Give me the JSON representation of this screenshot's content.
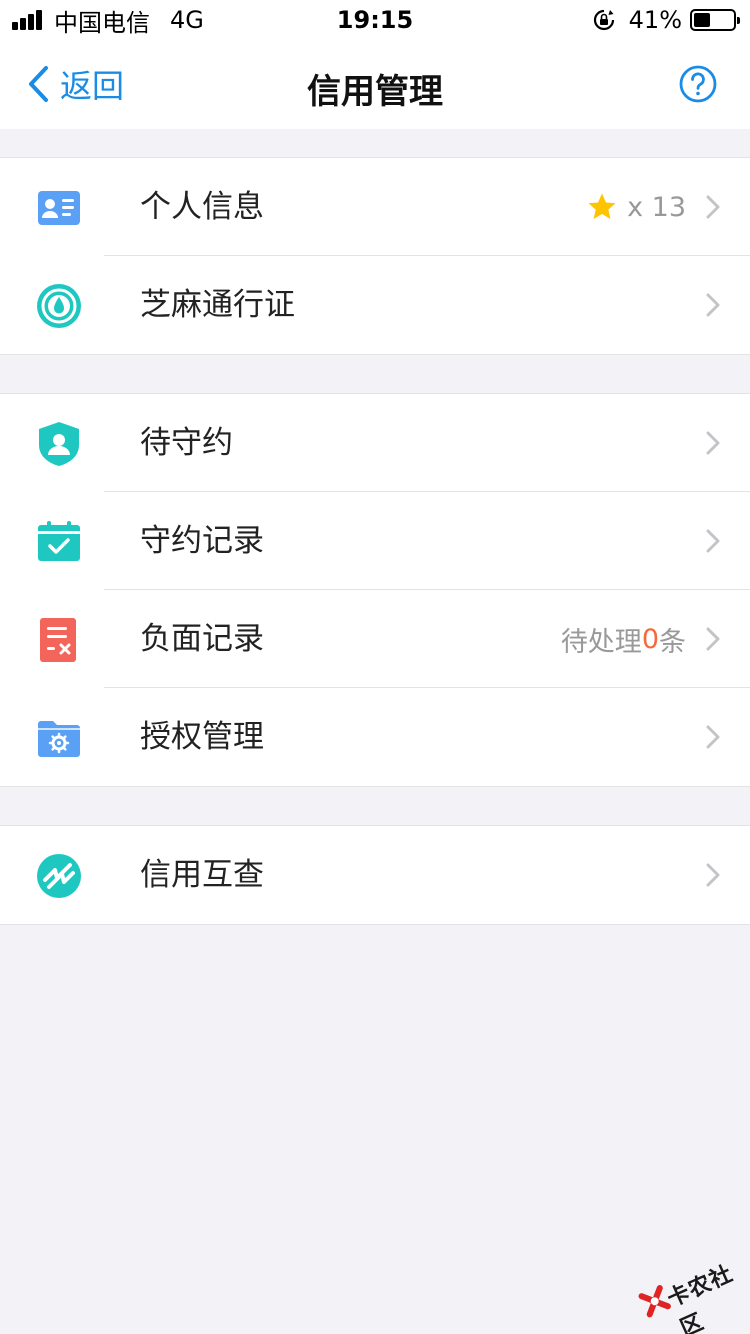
{
  "status_bar": {
    "carrier": "中国电信",
    "network": "4G",
    "time": "19:15",
    "battery_percent": "41%",
    "battery_level": 0.41,
    "icons": [
      "signal-bars-icon",
      "rotation-lock-icon",
      "battery-icon"
    ]
  },
  "nav": {
    "back_label": "返回",
    "title": "信用管理",
    "icons": [
      "chevron-left-icon",
      "question-circle-icon"
    ]
  },
  "groups": [
    {
      "items": [
        {
          "label": "个人信息",
          "icon": "id-card-icon",
          "badge_prefix": "x 13"
        },
        {
          "label": "芝麻通行证",
          "icon": "sesame-pass-icon"
        }
      ]
    },
    {
      "items": [
        {
          "label": "待守约",
          "icon": "shield-user-icon"
        },
        {
          "label": "守约记录",
          "icon": "calendar-check-icon"
        },
        {
          "label": "负面记录",
          "icon": "negative-record-icon",
          "pending_prefix": "待处理",
          "pending_count": "0",
          "pending_suffix": "条"
        },
        {
          "label": "授权管理",
          "icon": "folder-gear-icon"
        }
      ]
    },
    {
      "items": [
        {
          "label": "信用互查",
          "icon": "credit-check-icon"
        }
      ]
    }
  ],
  "watermark": {
    "text": "卡农社区"
  },
  "colors": {
    "accent": "#1a8ce6",
    "teal": "#1ec8c0",
    "blue_icon": "#5aa0f5",
    "red_icon": "#f3655a",
    "star": "#ffc400",
    "pending_count": "#f36a3c",
    "background": "#f2f2f7"
  }
}
